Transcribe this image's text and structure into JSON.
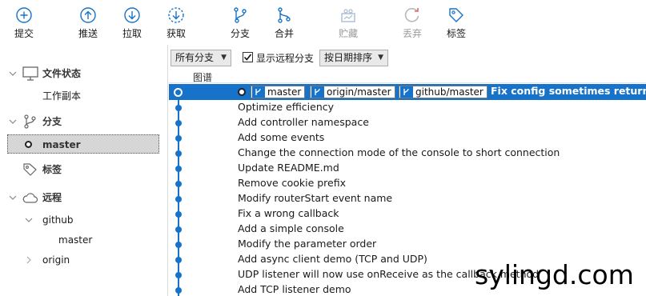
{
  "toolbar": {
    "commit": "提交",
    "push": "推送",
    "pull": "拉取",
    "fetch": "获取",
    "branch": "分支",
    "merge": "合并",
    "stash": "贮藏",
    "discard": "丢弃",
    "tag": "标签"
  },
  "sidebar": {
    "file_status": "文件状态",
    "working_copy": "工作副本",
    "branches": "分支",
    "current_branch": "master",
    "tags": "标签",
    "remotes": "远程",
    "remote_github": "github",
    "remote_github_branch": "master",
    "remote_origin": "origin"
  },
  "filter": {
    "branch_select": "所有分支",
    "show_remote_label": "显示远程分支",
    "show_remote_checked": true,
    "sort_select": "按日期排序"
  },
  "graph_header": "图谱",
  "commits": {
    "selected": {
      "refs": [
        "master",
        "origin/master",
        "github/master"
      ],
      "message": "Fix config sometimes returns an"
    },
    "rows": [
      "Optimize efficiency",
      "Add controller namespace",
      "Add some events",
      "Change the connection mode of the console to short connection",
      "Update README.md",
      "Remove cookie prefix",
      "Modify routerStart event name",
      "Fix a wrong callback",
      "Add a simple console",
      "Modify the parameter order",
      "Add async client demo (TCP and UDP)",
      "UDP listener will now use onReceive as the callback method",
      "Add TCP listener demo"
    ]
  },
  "watermark": "sylingd.com",
  "colors": {
    "accent": "#1673c9",
    "selection": "#1673c9"
  }
}
